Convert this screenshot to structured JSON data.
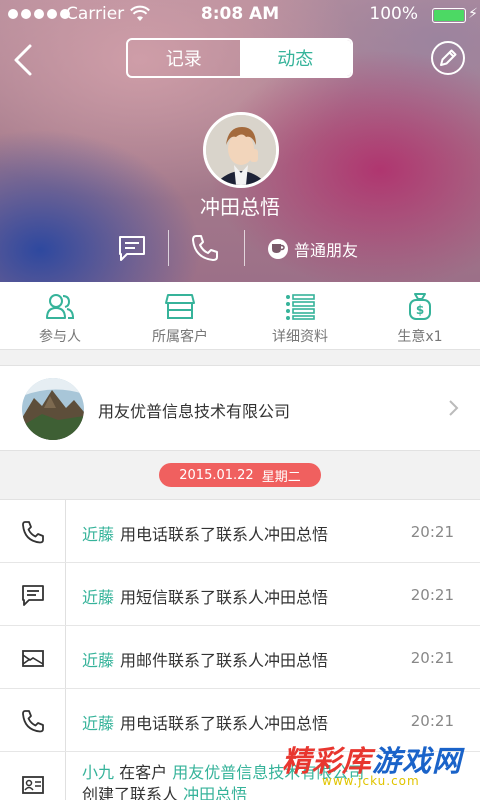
{
  "status_bar": {
    "carrier": "Carrier",
    "time": "8:08 AM",
    "battery_pct": "100%",
    "battery_level": 1.0
  },
  "header": {
    "segments": [
      {
        "label": "记录",
        "active": false
      },
      {
        "label": "动态",
        "active": true
      }
    ],
    "contact_name": "冲田总悟",
    "relationship_tag": "普通朋友"
  },
  "tabs": [
    {
      "label": "参与人",
      "icon": "participants-icon"
    },
    {
      "label": "所属客户",
      "icon": "store-icon"
    },
    {
      "label": "详细资料",
      "icon": "details-list-icon"
    },
    {
      "label": "生意x1",
      "icon": "money-bag-icon"
    }
  ],
  "company": {
    "name": "用友优普信息技术有限公司"
  },
  "date_label": {
    "date": "2015.01.22",
    "weekday": "星期二"
  },
  "timeline": [
    {
      "icon": "phone-icon",
      "who": "近藤",
      "action": "用电话联系了联系人冲田总悟",
      "time": "20:21"
    },
    {
      "icon": "message-icon",
      "who": "近藤",
      "action": "用短信联系了联系人冲田总悟",
      "time": "20:21"
    },
    {
      "icon": "mail-icon",
      "who": "近藤",
      "action": "用邮件联系了联系人冲田总悟",
      "time": "20:21"
    },
    {
      "icon": "phone-icon",
      "who": "近藤",
      "action": "用电话联系了联系人冲田总悟",
      "time": "20:21"
    }
  ],
  "last_entry": {
    "who": "小九",
    "mid": "在客户",
    "customer": "用友优普信息技术有限公司",
    "line2_prefix": "创建了联系人",
    "contact": "冲田总悟"
  },
  "watermark": {
    "part1": "精彩库",
    "part2": "游戏网",
    "url": "www.jcku.com"
  },
  "colors": {
    "accent": "#36b39a",
    "date_pill": "#f0605f",
    "battery": "#4cd964"
  }
}
